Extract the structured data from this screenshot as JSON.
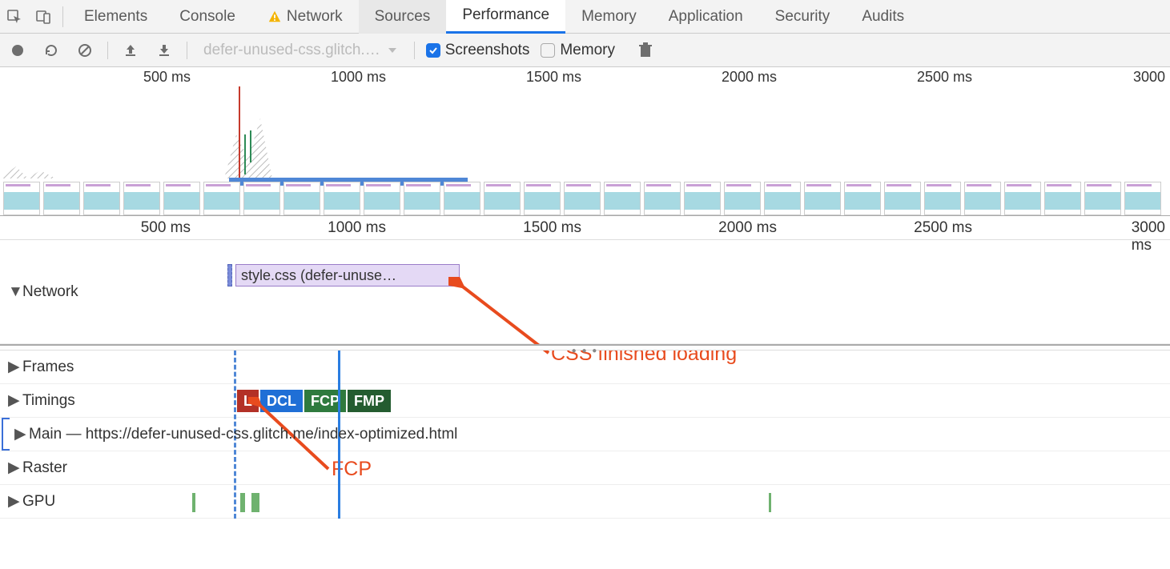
{
  "tabs": {
    "elements": "Elements",
    "console": "Console",
    "network": "Network",
    "sources": "Sources",
    "performance": "Performance",
    "memory": "Memory",
    "application": "Application",
    "security": "Security",
    "audits": "Audits"
  },
  "toolbar": {
    "dropdown_label": "defer-unused-css.glitch.…",
    "screenshots_label": "Screenshots",
    "memory_label": "Memory"
  },
  "overview_ticks": [
    "500 ms",
    "1000 ms",
    "1500 ms",
    "2000 ms",
    "2500 ms",
    "3000"
  ],
  "detail_ticks": [
    "500 ms",
    "1000 ms",
    "1500 ms",
    "2000 ms",
    "2500 ms",
    "3000 ms"
  ],
  "rows": {
    "network": "Network",
    "frames": "Frames",
    "timings": "Timings",
    "main": "Main — https://defer-unused-css.glitch.me/index-optimized.html",
    "raster": "Raster",
    "gpu": "GPU"
  },
  "network_item": "style.css (defer-unuse…",
  "timing_badges": {
    "l": "L",
    "dcl": "DCL",
    "fcp": "FCP",
    "fmp": "FMP"
  },
  "annotations": {
    "css_loaded": "CSS finished loading",
    "fcp": "FCP"
  }
}
